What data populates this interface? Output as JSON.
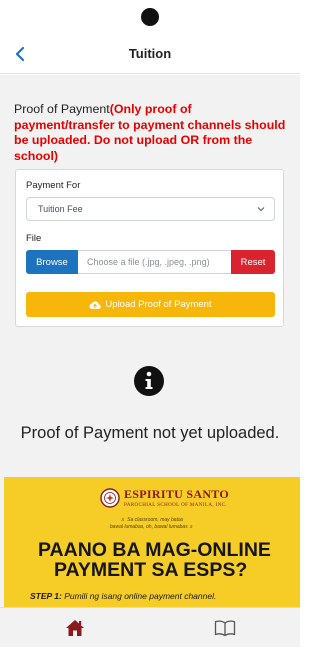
{
  "header": {
    "title": "Tuition"
  },
  "proof": {
    "heading": "Proof of Payment",
    "warning": "(Only proof of payment/transfer to payment channels should be uploaded. Do not upload OR from the school)"
  },
  "form": {
    "payment_for_label": "Payment For",
    "payment_for_value": "Tuition Fee",
    "file_label": "File",
    "browse_label": "Browse",
    "file_placeholder": "Choose a file (.jpg, .jpeg, .png)",
    "reset_label": "Reset",
    "upload_label": "Upload Proof of Payment"
  },
  "status": {
    "message": "Proof of Payment not yet uploaded."
  },
  "banner": {
    "school_name": "ESPIRITU SANTO",
    "school_sub": "PAROCHIAL SCHOOL OF MANILA, INC.",
    "tagline_1": "♬ Sa classroom, may batas",
    "tagline_2": "bawal lumabas, oh, bawal lumabas ♬",
    "headline_1": "PAANO BA MAG-ONLINE",
    "headline_2": "PAYMENT SA ESPS?",
    "step_label": "STEP 1:",
    "step_text": "Pumili ng isang online payment channel."
  },
  "colors": {
    "primary": "#1e73be",
    "danger": "#d9232e",
    "warning": "#f6b70a",
    "alert_text": "#e60000",
    "banner_bg": "#f6cc27",
    "nav_active": "#8b1a1a"
  },
  "icons": {
    "back": "chevron-left-icon",
    "dropdown": "chevron-down-icon",
    "upload": "cloud-upload-icon",
    "info": "info-circle-icon",
    "home": "home-icon",
    "book": "book-icon"
  }
}
